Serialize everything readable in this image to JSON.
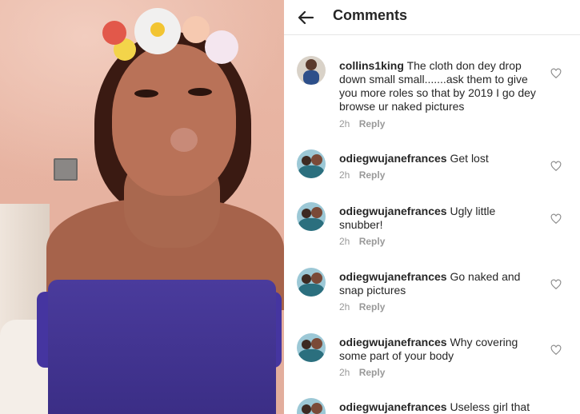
{
  "header": {
    "title": "Comments",
    "back_icon": "arrow-left-icon"
  },
  "comments": [
    {
      "username": "collins1king",
      "text": "The cloth don dey drop down small small.......ask them to give you more roles so that by 2019 I go dey browse ur naked pictures",
      "time": "2h",
      "reply": "Reply"
    },
    {
      "username": "odiegwujanefrances",
      "text": "Get lost",
      "time": "2h",
      "reply": "Reply"
    },
    {
      "username": "odiegwujanefrances",
      "text": "Ugly little snubber!",
      "time": "2h",
      "reply": "Reply"
    },
    {
      "username": "odiegwujanefrances",
      "text": "Go naked and snap pictures",
      "time": "2h",
      "reply": "Reply"
    },
    {
      "username": "odiegwujanefrances",
      "text": "Why covering some part of your body",
      "time": "2h",
      "reply": "Reply"
    },
    {
      "username": "odiegwujanefrances",
      "text": "Useless girl that",
      "time": "",
      "reply": ""
    }
  ],
  "icons": {
    "like": "heart-outline-icon"
  },
  "colors": {
    "text": "#262626",
    "muted": "#999999",
    "divider": "#e6e6e6"
  }
}
